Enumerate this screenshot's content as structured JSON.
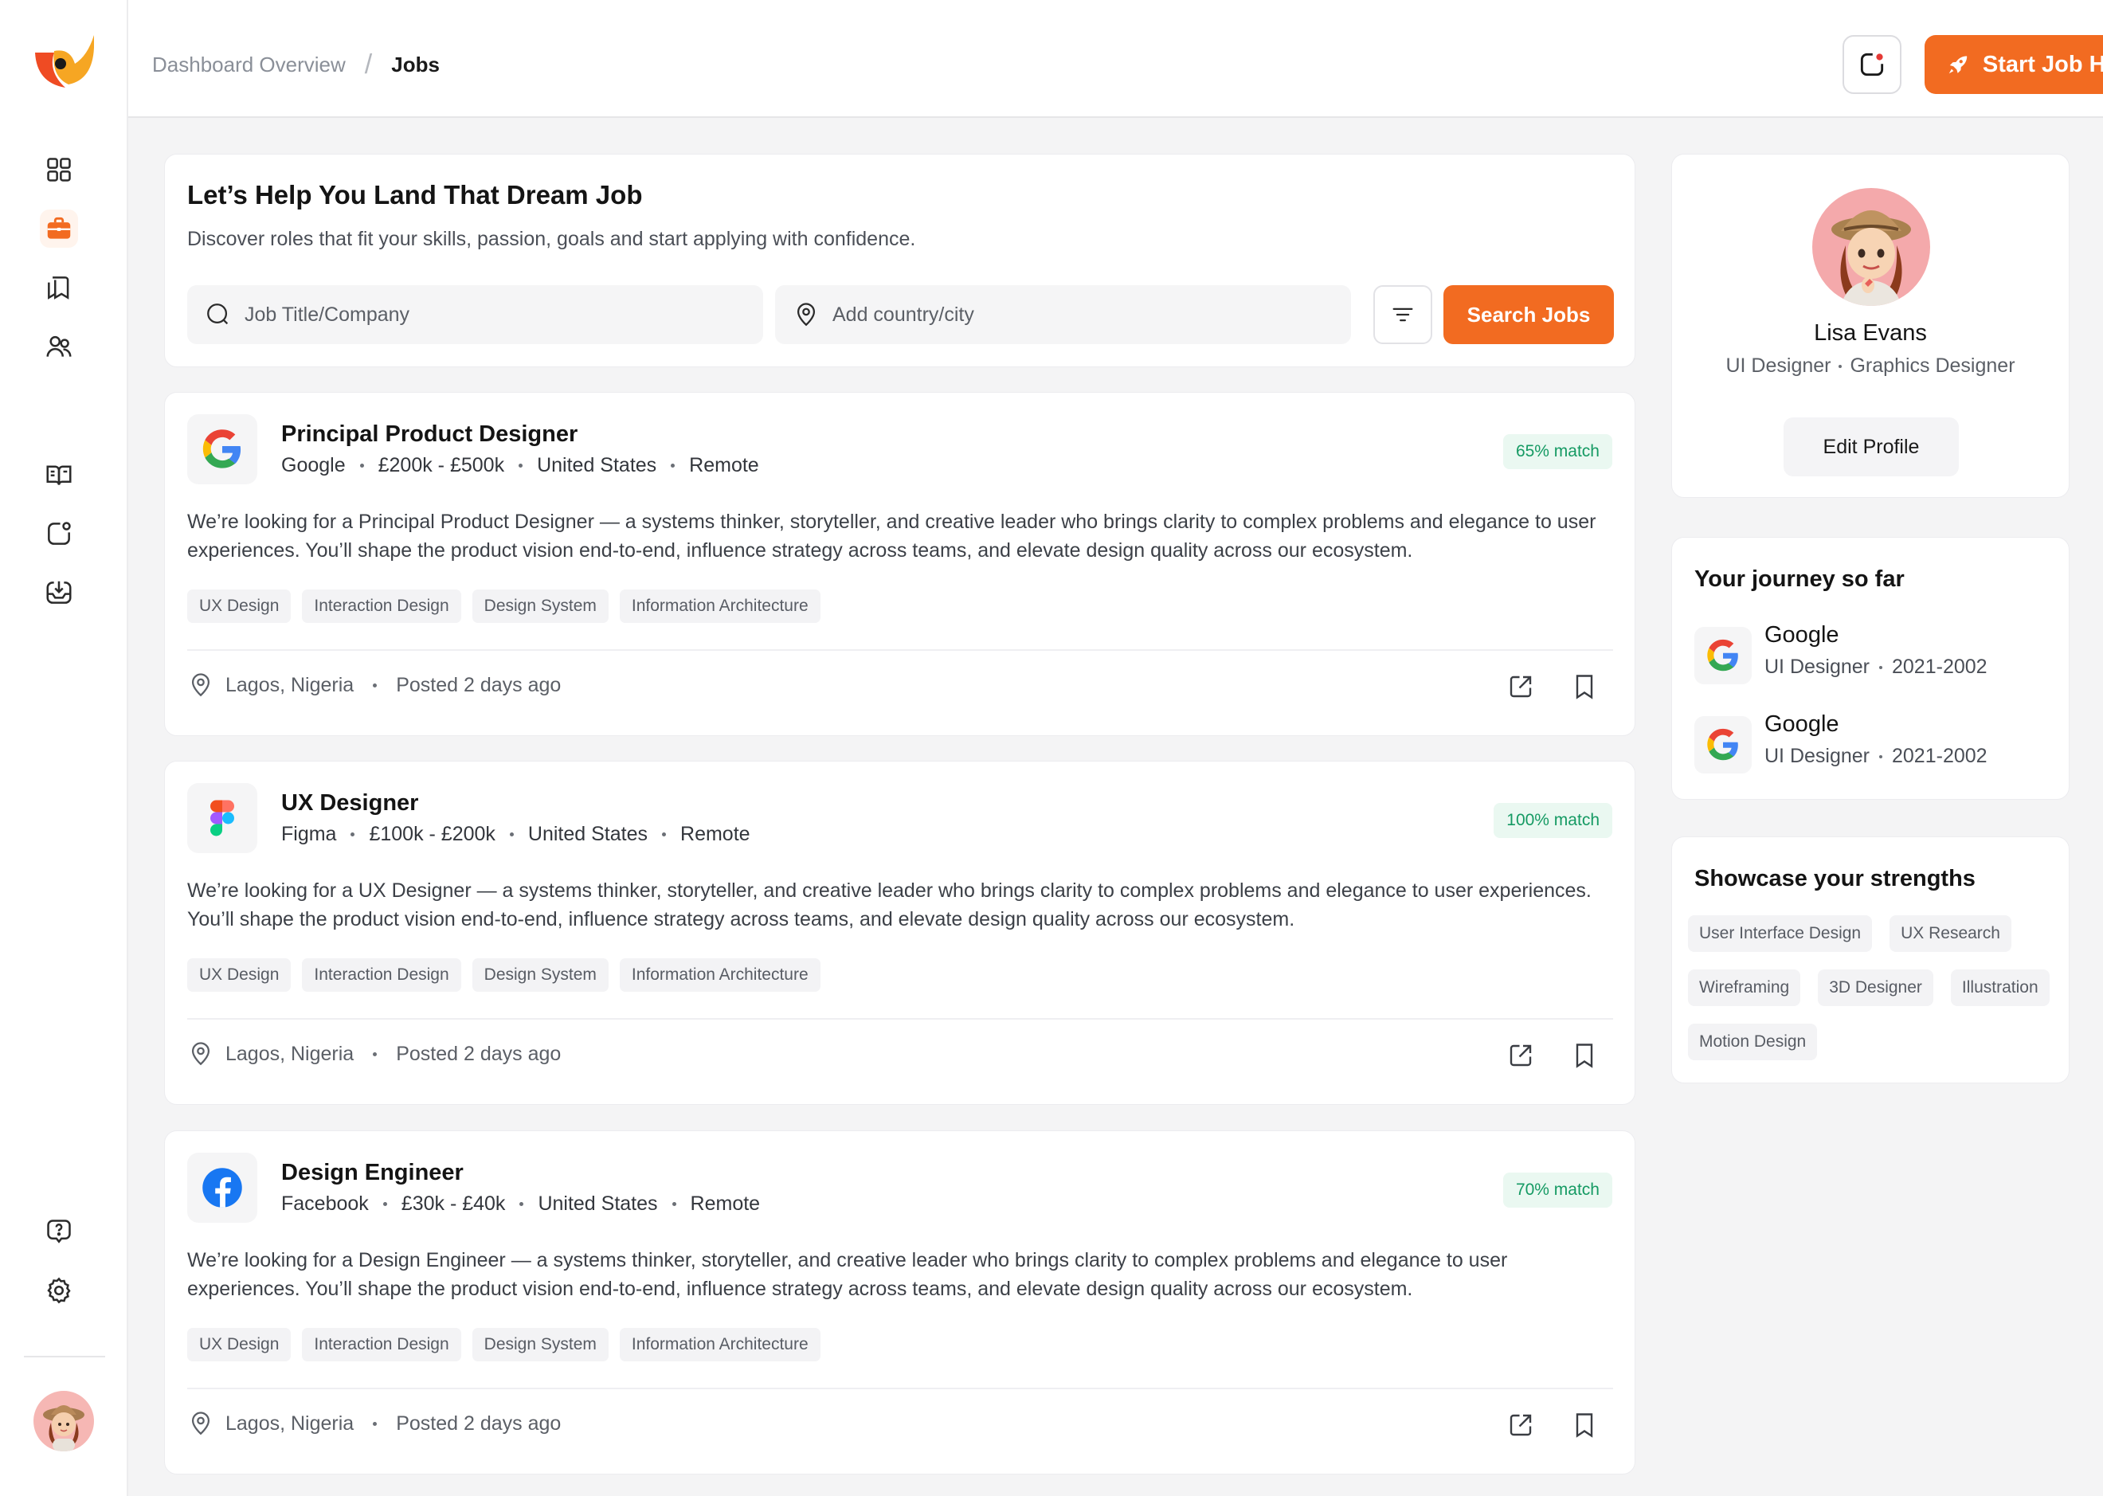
{
  "brand": {
    "accent": "#f26b21",
    "match_bg": "#eaf8f1",
    "match_text": "#159a63"
  },
  "sidebar": {
    "logo": "app-logo",
    "items": [
      {
        "icon": "grid-icon",
        "active": false
      },
      {
        "icon": "briefcase-icon",
        "active": true
      },
      {
        "icon": "bookmarks-icon",
        "active": false
      },
      {
        "icon": "users-icon",
        "active": false
      },
      {
        "icon": "book-open-icon",
        "active": false
      },
      {
        "icon": "notification-square-icon",
        "active": false
      },
      {
        "icon": "inbox-download-icon",
        "active": false
      },
      {
        "icon": "help-chat-icon",
        "active": false
      },
      {
        "icon": "settings-gear-icon",
        "active": false
      }
    ]
  },
  "header": {
    "breadcrumb": {
      "parent": "Dashboard Overview",
      "separator": "/",
      "current": "Jobs"
    },
    "cta_label": "Start Job Hunting"
  },
  "hero": {
    "title": "Let’s Help You Land That Dream Job",
    "subtitle": "Discover roles that fit your skills, passion, goals  and start applying with confidence.",
    "job_placeholder": "Job Title/Company",
    "location_placeholder": "Add country/city",
    "search_label": "Search Jobs"
  },
  "jobs": [
    {
      "title": "Principal Product Designer",
      "company": "Google",
      "salary": "£200k - £500k",
      "country": "United States",
      "mode": "Remote",
      "match": "65% match",
      "logo": "google-logo-icon",
      "description": "We’re looking for a Principal Product Designer — a systems thinker, storyteller, and creative leader who brings clarity to complex problems and elegance to user experiences. You’ll shape the product vision end-to-end, influence strategy across teams, and elevate design quality across our ecosystem.",
      "tags": [
        "UX Design",
        "Interaction Design",
        "Design System",
        "Information Architecture"
      ],
      "location": "Lagos, Nigeria",
      "posted": "Posted 2 days ago"
    },
    {
      "title": "UX Designer",
      "company": "Figma",
      "salary": "£100k - £200k",
      "country": "United States",
      "mode": "Remote",
      "match": "100% match",
      "logo": "figma-logo-icon",
      "description": "We’re looking for a UX Designer — a systems thinker, storyteller, and creative leader who brings clarity to complex problems and elegance to user experiences. You’ll shape the product vision end-to-end, influence strategy across teams, and elevate design quality across our ecosystem.",
      "tags": [
        "UX Design",
        "Interaction Design",
        "Design System",
        "Information Architecture"
      ],
      "location": "Lagos, Nigeria",
      "posted": "Posted 2 days ago"
    },
    {
      "title": "Design Engineer",
      "company": "Facebook",
      "salary": "£30k - £40k",
      "country": "United States",
      "mode": "Remote",
      "match": "70% match",
      "logo": "facebook-logo-icon",
      "description": "We’re looking for a Design Engineer — a systems thinker, storyteller, and creative leader who brings clarity to complex problems and elegance to user experiences. You’ll shape the product vision end-to-end, influence strategy across teams, and elevate design quality across our ecosystem.",
      "tags": [
        "UX Design",
        "Interaction Design",
        "Design System",
        "Information Architecture"
      ],
      "location": "Lagos, Nigeria",
      "posted": "Posted 2 days ago"
    }
  ],
  "profile": {
    "name": "Lisa Evans",
    "role_primary": "UI Designer",
    "role_secondary": "Graphics Designer",
    "edit_label": "Edit Profile"
  },
  "journey": {
    "title": "Your journey so far",
    "items": [
      {
        "company": "Google",
        "role": "UI Designer",
        "years": "2021-2002"
      },
      {
        "company": "Google",
        "role": "UI Designer",
        "years": "2021-2002"
      }
    ]
  },
  "strengths": {
    "title": "Showcase your strengths",
    "tags": [
      "User Interface Design",
      "UX Research",
      "Wireframing",
      "3D Designer",
      "Illustration",
      "Motion Design"
    ]
  }
}
